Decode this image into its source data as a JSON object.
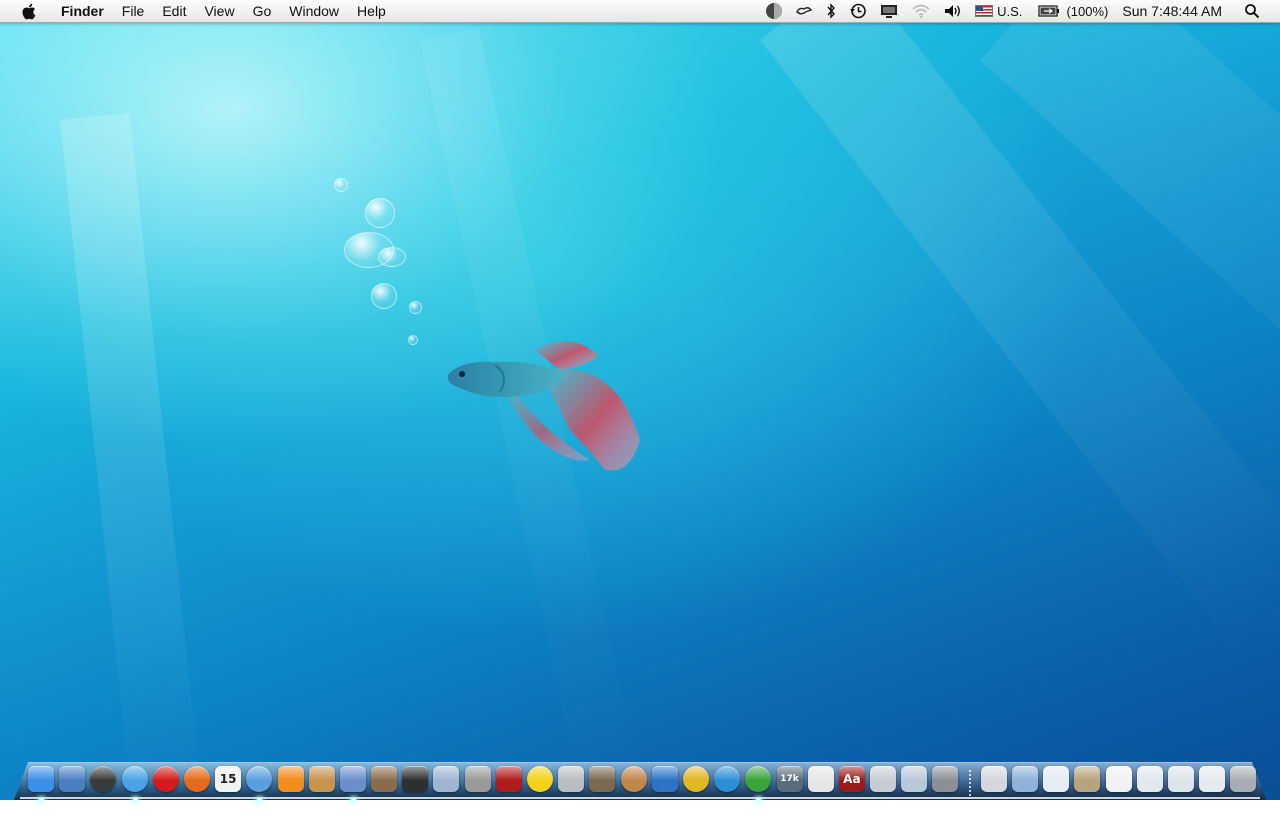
{
  "menubar": {
    "apple_icon": "apple-logo-icon",
    "app_name": "Finder",
    "menus": [
      "File",
      "Edit",
      "View",
      "Go",
      "Window",
      "Help"
    ],
    "status_items": [
      {
        "name": "growl-icon"
      },
      {
        "name": "cloud-sync-icon"
      },
      {
        "name": "bluetooth-icon"
      },
      {
        "name": "time-machine-icon"
      },
      {
        "name": "display-mirroring-icon"
      },
      {
        "name": "wifi-icon"
      },
      {
        "name": "volume-icon"
      }
    ],
    "input_source": "U.S.",
    "battery": "(100%)",
    "battery_level": 1.0,
    "clock": "Sun 7:48:44 AM",
    "spotlight_icon": "spotlight-search-icon"
  },
  "desktop": {
    "wallpaper": "betta-fish-underwater",
    "colors": {
      "light": "#7aeef8",
      "mid": "#14a6d8",
      "deep": "#0b4f96"
    }
  },
  "dock": {
    "apps": [
      {
        "name": "finder",
        "color": "#3d8ee8",
        "running": true
      },
      {
        "name": "preview",
        "color": "#4b7fc4",
        "running": false
      },
      {
        "name": "dashboard",
        "color": "#3a3a3a",
        "running": false
      },
      {
        "name": "safari",
        "color": "#4aa3e6",
        "running": true
      },
      {
        "name": "opera",
        "color": "#d41a1a",
        "running": false
      },
      {
        "name": "firefox",
        "color": "#e66a1c",
        "running": false
      },
      {
        "name": "ical",
        "color": "#f2f2f2",
        "text": "15",
        "running": false
      },
      {
        "name": "itunes",
        "color": "#5aa0e0",
        "running": true
      },
      {
        "name": "vlc",
        "color": "#f28c1a",
        "running": false
      },
      {
        "name": "address-book",
        "color": "#c8934a",
        "running": false
      },
      {
        "name": "itunes-artwork",
        "color": "#6b8fc9",
        "running": true
      },
      {
        "name": "iphoto",
        "color": "#8a6c4c",
        "running": false
      },
      {
        "name": "imovie",
        "color": "#2f2f2f",
        "running": false
      },
      {
        "name": "system-profiler",
        "color": "#9fb6d2",
        "running": false
      },
      {
        "name": "dvd-player",
        "color": "#9a9a9a",
        "running": false
      },
      {
        "name": "photo-booth",
        "color": "#b01c1c",
        "running": false
      },
      {
        "name": "yahoo-messenger",
        "color": "#f4d21a",
        "running": false
      },
      {
        "name": "calculator",
        "color": "#b9bcc0",
        "running": false
      },
      {
        "name": "gimp",
        "color": "#7b6a4e",
        "running": false
      },
      {
        "name": "celestia",
        "color": "#c0874a",
        "running": false
      },
      {
        "name": "wave-app",
        "color": "#2c74c6",
        "running": false
      },
      {
        "name": "burn",
        "color": "#e2b722",
        "running": false
      },
      {
        "name": "skype",
        "color": "#2b8fd6",
        "running": false
      },
      {
        "name": "utorrent",
        "color": "#3aa33a",
        "running": true
      },
      {
        "name": "activity-monitor",
        "color": "#5a6b7c",
        "text": "17k",
        "running": false
      },
      {
        "name": "textedit",
        "color": "#e6e6e6",
        "running": false
      },
      {
        "name": "dictionary",
        "color": "#9e1b1b",
        "text": "Aa",
        "running": false
      },
      {
        "name": "printer-setup",
        "color": "#c9cdd3",
        "running": false
      },
      {
        "name": "iweb",
        "color": "#b7c8da",
        "running": false
      },
      {
        "name": "system-preferences",
        "color": "#8c8f94",
        "running": false
      }
    ],
    "stacks": [
      {
        "name": "hard-drive",
        "color": "#d4d8de"
      },
      {
        "name": "documents-folder",
        "color": "#8fb2d8"
      },
      {
        "name": "music-file",
        "color": "#e6ecf3"
      },
      {
        "name": "pictures-stack",
        "color": "#b6a47a"
      },
      {
        "name": "desktop-item",
        "color": "#f2f2f2"
      },
      {
        "name": "document-stack",
        "color": "#e2e8f0"
      },
      {
        "name": "downloads-stack",
        "color": "#dde4ec"
      },
      {
        "name": "mail-stack",
        "color": "#e7ebef"
      },
      {
        "name": "trash",
        "color": "#a9adb3"
      }
    ]
  }
}
